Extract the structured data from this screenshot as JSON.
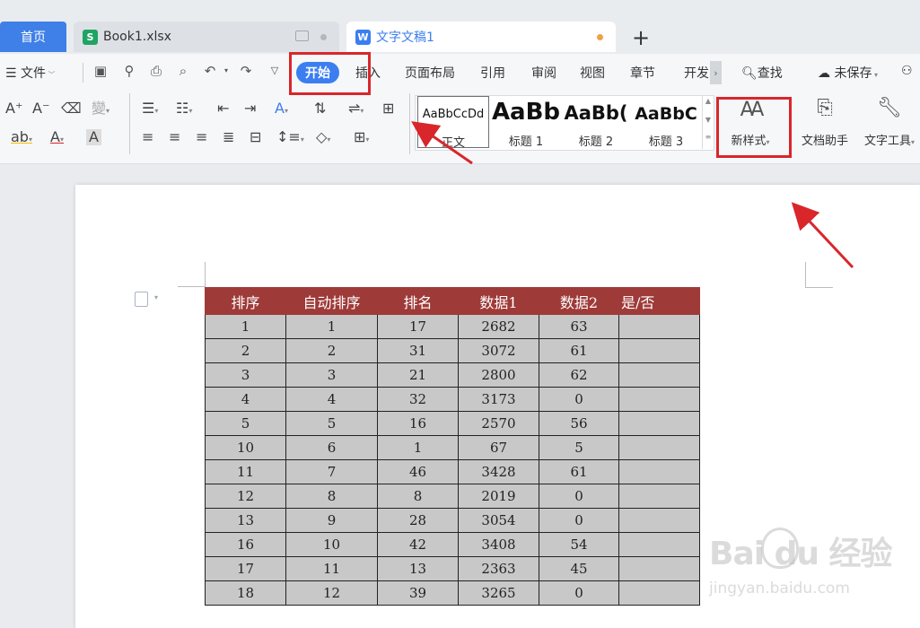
{
  "tabs": {
    "home": "首页",
    "book": "Book1.xlsx",
    "book_icon": "S",
    "word": "文字文稿1",
    "word_icon": "W",
    "new_tab": "+"
  },
  "menu": {
    "file": "文件",
    "start": "开始",
    "insert": "插入",
    "layout": "页面布局",
    "references": "引用",
    "review": "审阅",
    "view": "视图",
    "chapter": "章节",
    "developer": "开发",
    "search": "查找",
    "save_status": "未保存"
  },
  "styles": {
    "normal_sample": "AaBbCcDd",
    "normal_label": "正文",
    "h1_sample": "AaBb",
    "h1_label": "标题 1",
    "h2_sample": "AaBb(",
    "h2_label": "标题 2",
    "h3_sample": "AaBbC",
    "h3_label": "标题 3"
  },
  "buttons": {
    "new_style": "新样式",
    "doc_assistant": "文档助手",
    "text_tools": "文字工具"
  },
  "table": {
    "headers": [
      "排序",
      "自动排序",
      "排名",
      "数据1",
      "数据2",
      "是/否"
    ],
    "rows": [
      [
        "1",
        "1",
        "17",
        "2682",
        "63",
        ""
      ],
      [
        "2",
        "2",
        "31",
        "3072",
        "61",
        ""
      ],
      [
        "3",
        "3",
        "21",
        "2800",
        "62",
        ""
      ],
      [
        "4",
        "4",
        "32",
        "3173",
        "0",
        ""
      ],
      [
        "5",
        "5",
        "16",
        "2570",
        "56",
        ""
      ],
      [
        "10",
        "6",
        "1",
        "67",
        "5",
        ""
      ],
      [
        "11",
        "7",
        "46",
        "3428",
        "61",
        ""
      ],
      [
        "12",
        "8",
        "8",
        "2019",
        "0",
        ""
      ],
      [
        "13",
        "9",
        "28",
        "3054",
        "0",
        ""
      ],
      [
        "16",
        "10",
        "42",
        "3408",
        "54",
        ""
      ],
      [
        "17",
        "11",
        "13",
        "2363",
        "45",
        ""
      ],
      [
        "18",
        "12",
        "39",
        "3265",
        "0",
        ""
      ]
    ]
  },
  "watermark": {
    "logo": "Bai du 经验",
    "url": "jingyan.baidu.com"
  },
  "colors": {
    "accent": "#3b7ef0",
    "highlight": "#d9262b",
    "table_header": "#9e3a38",
    "table_cell": "#c8c8c8"
  }
}
